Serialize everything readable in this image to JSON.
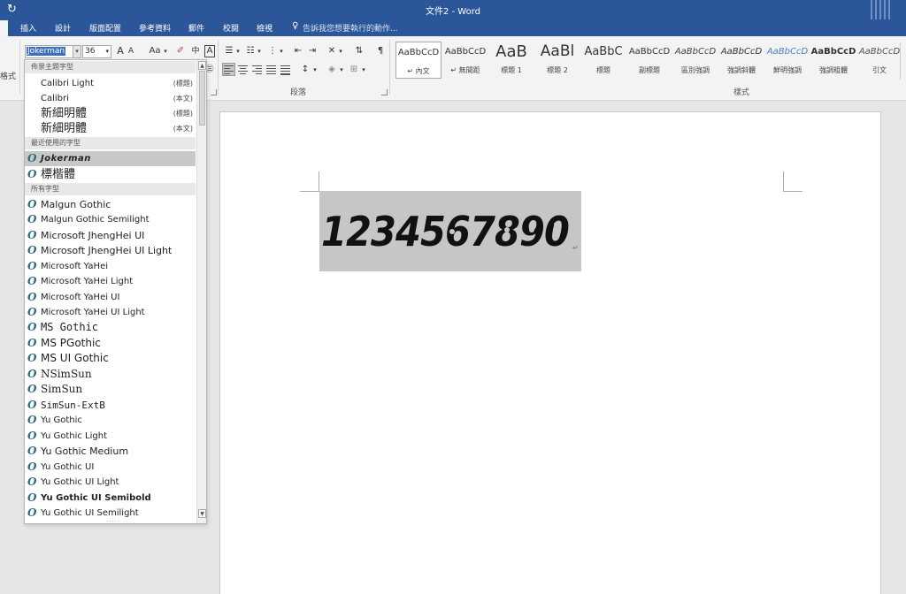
{
  "title_bar": {
    "title": "文件2 - Word",
    "undo_icon": "refresh-icon"
  },
  "tabs": [
    {
      "label": "插入"
    },
    {
      "label": "設計"
    },
    {
      "label": "版面配置"
    },
    {
      "label": "參考資料"
    },
    {
      "label": "郵件"
    },
    {
      "label": "校閱"
    },
    {
      "label": "檢視"
    }
  ],
  "tell_me": {
    "placeholder": "告訴我您想要執行的動作..."
  },
  "ribbon": {
    "clipboard_label_partial": "格式",
    "font": {
      "name": "Jokerman",
      "size": "36",
      "grow": "A",
      "shrink": "A",
      "case": "Aa",
      "box_letter": "A"
    },
    "paragraph_label": "段落",
    "styles_label": "樣式",
    "styles": [
      {
        "sample": "AaBbCcD",
        "name": "↵ 內文",
        "color": "#000000"
      },
      {
        "sample": "AaBbCcD",
        "name": "↵ 無間距",
        "color": "#000000"
      },
      {
        "sample": "AaB",
        "name": "標題 1",
        "color": "#000000"
      },
      {
        "sample": "AaBl",
        "name": "標題 2",
        "color": "#000000"
      },
      {
        "sample": "AaBbC",
        "name": "標題",
        "color": "#000000"
      },
      {
        "sample": "AaBbCcD",
        "name": "副標題",
        "color": "#000000"
      },
      {
        "sample": "AaBbCcD",
        "name": "區別強調",
        "color": "#444444"
      },
      {
        "sample": "AaBbCcD",
        "name": "強調斜體",
        "color": "#000000"
      },
      {
        "sample": "AaBbCcD",
        "name": "鮮明強調",
        "color": "#4a7fc0"
      },
      {
        "sample": "AaBbCcD",
        "name": "強調粗體",
        "color": "#000000"
      },
      {
        "sample": "AaBbCcD",
        "name": "引文",
        "color": "#555555"
      }
    ]
  },
  "font_dropdown": {
    "sections": {
      "theme": "佈景主題字型",
      "recent": "最近使用的字型",
      "all": "所有字型"
    },
    "theme_fonts": [
      {
        "name": "Calibri Light",
        "tag": "(標題)"
      },
      {
        "name": "Calibri",
        "tag": "(本文)"
      },
      {
        "name": "新細明體",
        "tag": "(標題)"
      },
      {
        "name": "新細明體",
        "tag": "(本文)"
      }
    ],
    "recent_fonts": [
      {
        "name": "Jokerman"
      },
      {
        "name": "標楷體"
      }
    ],
    "all_fonts": [
      {
        "name": "Malgun Gothic"
      },
      {
        "name": "Malgun Gothic Semilight"
      },
      {
        "name": "Microsoft JhengHei UI"
      },
      {
        "name": "Microsoft JhengHei UI Light"
      },
      {
        "name": "Microsoft YaHei"
      },
      {
        "name": "Microsoft YaHei Light"
      },
      {
        "name": "Microsoft YaHei UI"
      },
      {
        "name": "Microsoft YaHei UI Light"
      },
      {
        "name": "MS Gothic"
      },
      {
        "name": "MS PGothic"
      },
      {
        "name": "MS UI Gothic"
      },
      {
        "name": "NSimSun"
      },
      {
        "name": "SimSun"
      },
      {
        "name": "SimSun-ExtB"
      },
      {
        "name": "Yu Gothic"
      },
      {
        "name": "Yu Gothic Light"
      },
      {
        "name": "Yu Gothic Medium"
      },
      {
        "name": "Yu Gothic UI"
      },
      {
        "name": "Yu Gothic UI Light"
      },
      {
        "name": "Yu Gothic UI Semibold"
      },
      {
        "name": "Yu Gothic UI Semilight"
      }
    ],
    "opentype_icon": "opentype-font-icon"
  },
  "document": {
    "text": "1234567890",
    "selection_color": "#c6c6c6",
    "pilcrow": "↵"
  }
}
